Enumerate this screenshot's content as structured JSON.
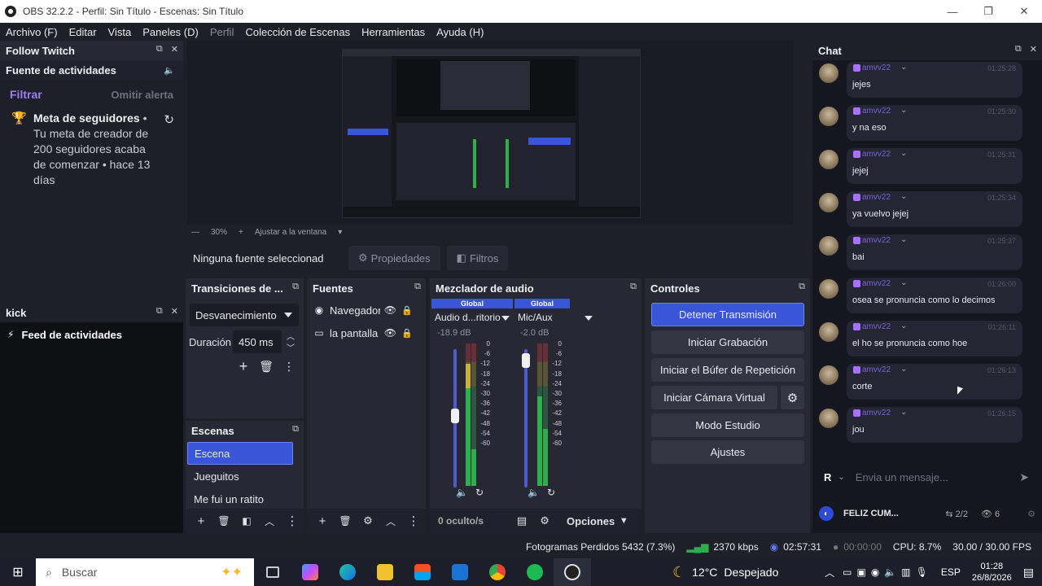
{
  "titlebar": {
    "title": "OBS 32.2.2 - Perfil: Sin Título - Escenas: Sin Título",
    "minimize": "—",
    "maximize": "❐",
    "close": "✕"
  },
  "menu": [
    "Archivo (F)",
    "Editar",
    "Vista",
    "Paneles (D)",
    "Perfil",
    "Colección de Escenas",
    "Herramientas",
    "Ayuda (H)"
  ],
  "follow_panel": {
    "title": "Follow Twitch",
    "feed_title": "Fuente de actividades",
    "filter": "Filtrar",
    "skip_alert": "Omitir alerta",
    "goal_title": "Meta de seguidores",
    "goal_text": " • Tu meta de creador de 200 seguidores acaba de comenzar • hace 13 días"
  },
  "kick_panel": {
    "title": "kick",
    "feed": "Feed de actividades"
  },
  "preview": {
    "zoom": "30%",
    "fit": "Ajustar a la ventana"
  },
  "source_bar": {
    "no_source": "Ninguna fuente seleccionad",
    "properties": "Propiedades",
    "filters": "Filtros"
  },
  "transitions": {
    "title": "Transiciones de ...",
    "selected": "Desvanecimiento",
    "duration_label": "Duración",
    "duration_value": "450 ms"
  },
  "scenes": {
    "title": "Escenas",
    "items": [
      "Escena",
      "Jueguitos",
      "Me fui un ratito"
    ],
    "selected_index": 0
  },
  "sources": {
    "title": "Fuentes",
    "items": [
      {
        "name": "Navegador",
        "icon": "globe-icon"
      },
      {
        "name": "la pantalla",
        "icon": "monitor-icon"
      }
    ]
  },
  "mixer": {
    "title": "Mezclador de audio",
    "channels": [
      {
        "scope": "Global",
        "name": "Audio d...ritorio",
        "db": "-18.9 dB",
        "fader_level": 0.55
      },
      {
        "scope": "Global",
        "name": "Mic/Aux",
        "db": "-2.0 dB",
        "fader_level": 0.95
      }
    ],
    "scale": [
      "0",
      "-6",
      "-12",
      "-18",
      "-24",
      "-30",
      "-36",
      "-42",
      "-48",
      "-54",
      "-60"
    ],
    "hidden": "0 oculto/s",
    "options": "Opciones"
  },
  "controls": {
    "title": "Controles",
    "buttons": [
      "Detener Transmisión",
      "Iniciar Grabación",
      "Iniciar el Búfer de Repetición",
      "Iniciar Cámara Virtual",
      "Modo Estudio",
      "Ajustes"
    ]
  },
  "chat": {
    "title": "Chat",
    "messages": [
      {
        "user": "amvv22",
        "time": "01:25:28",
        "text": "jejes"
      },
      {
        "user": "amvv22",
        "time": "01:25:30",
        "text": "y na eso"
      },
      {
        "user": "amvv22",
        "time": "01:25:31",
        "text": "jejej"
      },
      {
        "user": "amvv22",
        "time": "01:25:34",
        "text": "ya vuelvo jejej"
      },
      {
        "user": "amvv22",
        "time": "01:25:37",
        "text": "bai"
      },
      {
        "user": "amvv22",
        "time": "01:26:00",
        "text": "osea se pronuncia como lo decimos"
      },
      {
        "user": "amvv22",
        "time": "01:26:11",
        "text": "el ho se pronuncia como hoe"
      },
      {
        "user": "amvv22",
        "time": "01:26:13",
        "text": "corte"
      },
      {
        "user": "amvv22",
        "time": "01:26:15",
        "text": "jou"
      }
    ],
    "input_prefix": "R",
    "placeholder": "Envia un mensaje...",
    "stream_title": "FELIZ CUM...",
    "count": "2/2",
    "viewers": "6"
  },
  "status": {
    "dropped": "Fotogramas Perdidos 5432 (7.3%)",
    "bitrate": "2370 kbps",
    "stream_time": "02:57:31",
    "rec_time": "00:00:00",
    "cpu": "CPU: 8.7%",
    "fps": "30.00 / 30.00 FPS"
  },
  "taskbar": {
    "search": "Buscar",
    "temp": "12°C",
    "weather": "Despejado",
    "lang": "ESP",
    "time": "01:28",
    "date": "26/8/2026"
  },
  "colors": {
    "accent": "#3a56d8",
    "twitch": "#a970ff",
    "bg": "#1e1f29",
    "dock": "#272834"
  }
}
